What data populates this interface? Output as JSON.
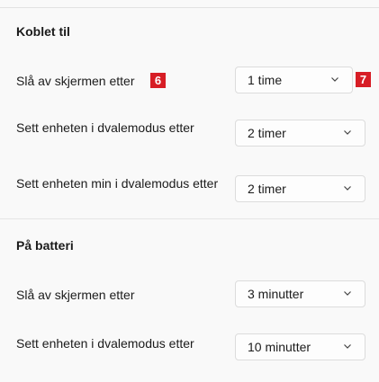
{
  "plugged_in": {
    "title": "Koblet til",
    "rows": [
      {
        "label": "Slå av skjermen etter",
        "value": "1 time",
        "badge": "6",
        "dropdown_badge": "7"
      },
      {
        "label": "Sett enheten i dvalemodus etter",
        "value": "2 timer"
      },
      {
        "label": "Sett enheten min i dvalemodus etter",
        "value": "2 timer"
      }
    ]
  },
  "on_battery": {
    "title": "På batteri",
    "rows": [
      {
        "label": "Slå av skjermen etter",
        "value": "3 minutter"
      },
      {
        "label": "Sett enheten i dvalemodus etter",
        "value": "10 minutter"
      }
    ]
  },
  "colors": {
    "badge": "#d71d25",
    "accent_text": "#1b1b1b"
  },
  "icons": {
    "chevron": "chevron-down-icon"
  }
}
